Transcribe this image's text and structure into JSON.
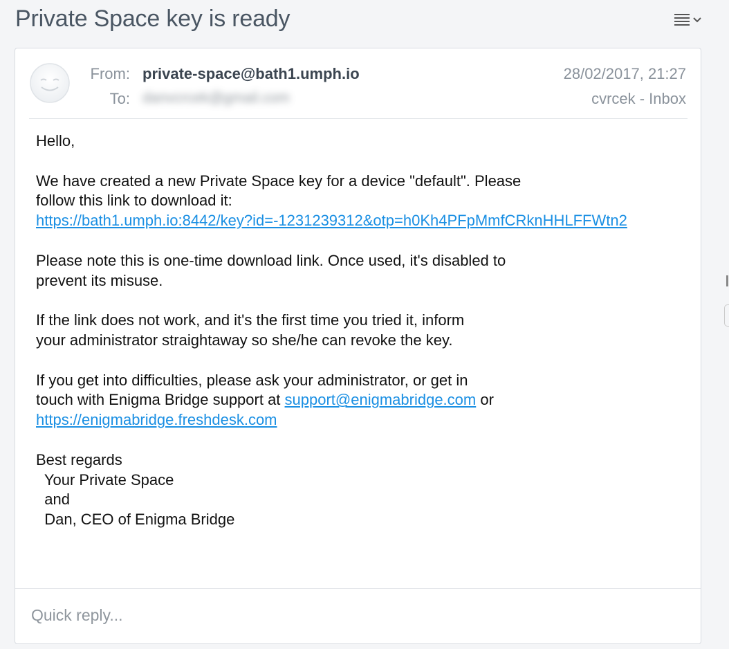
{
  "subject": "Private Space key is ready",
  "header": {
    "from_label": "From:",
    "from_value": "private-space@bath1.umph.io",
    "to_label": "To:",
    "to_value": "danvcrcek@gmail.com",
    "date": "28/02/2017, 21:27",
    "folder": "cvrcek - Inbox"
  },
  "body": {
    "greeting": "Hello,",
    "p1_line1": "We have created a new Private Space key for a device \"default\". Please",
    "p1_line2": "follow this link to download it:",
    "key_link": "https://bath1.umph.io:8442/key?id=-1231239312&otp=h0Kh4PFpMmfCRknHHLFFWtn2",
    "p2_line1": "Please note this is one-time download link. Once used, it's disabled to",
    "p2_line2": "prevent its misuse.",
    "p3_line1": "If the link does not work, and it's the first time you tried it, inform",
    "p3_line2": "your administrator straightaway so she/he can revoke the key.",
    "p4_line1": "If you get into difficulties, please ask your administrator, or get in",
    "p4_line2_prefix": "touch with Enigma Bridge support at ",
    "support_email": "support@enigmabridge.com",
    "p4_line2_suffix": " or",
    "freshdesk_link": "https://enigmabridge.freshdesk.com",
    "sig_line1": "Best regards",
    "sig_line2": "  Your Private Space",
    "sig_line3": "  and",
    "sig_line4": "  Dan, CEO of Enigma Bridge"
  },
  "quick_reply": {
    "placeholder": "Quick reply..."
  },
  "icons": {
    "menu": "hamburger-menu-icon",
    "chevron": "chevron-down-icon",
    "avatar": "smiley-avatar-icon"
  },
  "colors": {
    "link": "#1a8fe3",
    "subject": "#4a5663"
  }
}
